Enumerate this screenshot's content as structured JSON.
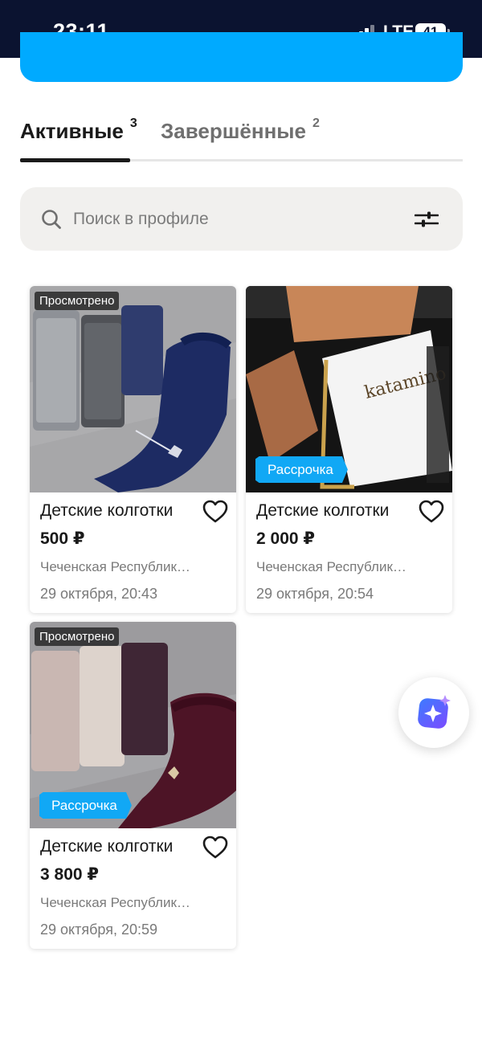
{
  "status_bar": {
    "time": "23:11",
    "network": "LTE",
    "battery": "41"
  },
  "tabs": [
    {
      "label": "Активные",
      "count": "3"
    },
    {
      "label": "Завершённые",
      "count": "2"
    }
  ],
  "search": {
    "placeholder": "Поиск в профиле",
    "value": ""
  },
  "listings": [
    {
      "badge": "Просмотрено",
      "installment": "",
      "title": "Детские колготки",
      "price": "500 ₽",
      "location": "Чеченская Республик…",
      "date": "29 октября, 20:43"
    },
    {
      "badge": "",
      "installment": "Рассрочка",
      "title": "Детские колготки",
      "price": "2 000 ₽",
      "location": "Чеченская Республик…",
      "date": "29 октября, 20:54"
    },
    {
      "badge": "Просмотрено",
      "installment": "Рассрочка",
      "title": "Детские колготки",
      "price": "3 800 ₽",
      "location": "Чеченская Республик…",
      "date": "29 октября, 20:59"
    }
  ],
  "colors": {
    "accent": "#00aaff",
    "status_bar": "#0b1330",
    "installment": "#11a8f5"
  },
  "icons": {
    "search": "search-icon",
    "filter": "filter-icon",
    "favorite": "heart-icon",
    "assistant": "assistant-icon"
  }
}
